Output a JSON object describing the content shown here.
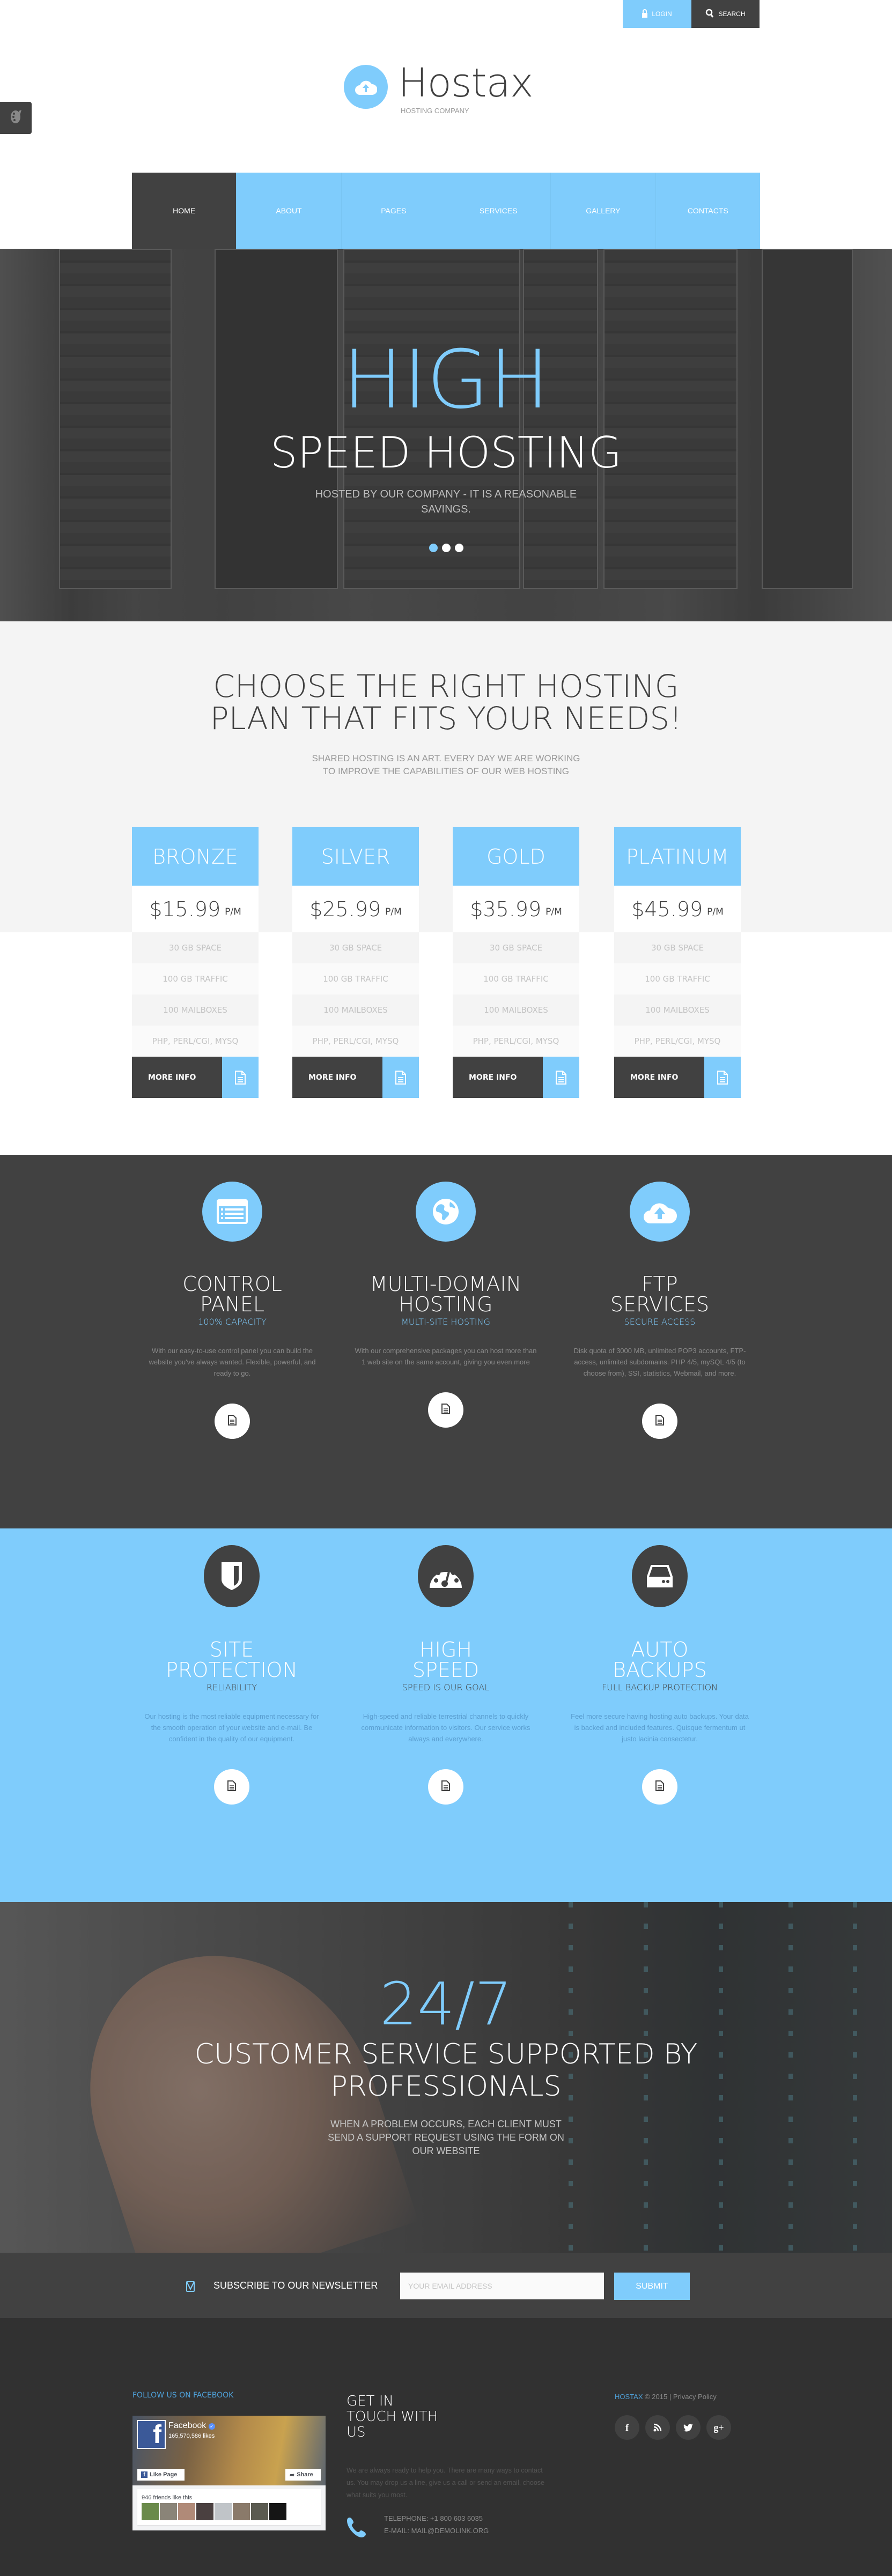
{
  "topbar": {
    "login_label": "LOGIN",
    "search_label": "SEARCH"
  },
  "brand": {
    "name": "Hostax",
    "tagline": "HOSTING COMPANY"
  },
  "nav": {
    "items": [
      {
        "label": "HOME",
        "active": true
      },
      {
        "label": "ABOUT"
      },
      {
        "label": "PAGES"
      },
      {
        "label": "SERVICES"
      },
      {
        "label": "GALLERY"
      },
      {
        "label": "CONTACTS"
      }
    ]
  },
  "hero": {
    "title": "HIGH",
    "subtitle": "SPEED HOSTING",
    "text": "HOSTED BY OUR COMPANY - IT IS A REASONABLE SAVINGS.",
    "slides": 3,
    "active_slide": 1
  },
  "plans": {
    "title_line1": "CHOOSE THE RIGHT HOSTING",
    "title_line2": "PLAN THAT FITS YOUR NEEDS!",
    "sub_line1": "SHARED HOSTING IS AN ART. EVERY DAY WE ARE WORKING",
    "sub_line2": "TO IMPROVE THE CAPABILITIES OF OUR WEB HOSTING",
    "items": [
      {
        "name": "BRONZE",
        "price": "$15.99",
        "period": "P/M",
        "features": [
          "30 GB SPACE",
          "100 GB TRAFFIC",
          "100 MAILBOXES",
          "PHP, PERL/CGI, MYSQ"
        ],
        "button": "MORE INFO"
      },
      {
        "name": "SILVER",
        "price": "$25.99",
        "period": "P/M",
        "features": [
          "30 GB SPACE",
          "100 GB TRAFFIC",
          "100 MAILBOXES",
          "PHP, PERL/CGI, MYSQ"
        ],
        "button": "MORE INFO"
      },
      {
        "name": "GOLD",
        "price": "$35.99",
        "period": "P/M",
        "features": [
          "30 GB SPACE",
          "100 GB TRAFFIC",
          "100 MAILBOXES",
          "PHP, PERL/CGI, MYSQ"
        ],
        "button": "MORE INFO"
      },
      {
        "name": "PLATINUM",
        "price": "$45.99",
        "period": "P/M",
        "features": [
          "30 GB SPACE",
          "100 GB TRAFFIC",
          "100 MAILBOXES",
          "PHP, PERL/CGI, MYSQ"
        ],
        "button": "MORE INFO"
      }
    ]
  },
  "features_dark": [
    {
      "icon": "control-panel-icon",
      "title1": "CONTROL",
      "title2": "PANEL",
      "sub": "100% CAPACITY",
      "desc": "With our easy-to-use control panel you can build the website you've always wanted. Flexible, powerful, and ready to go."
    },
    {
      "icon": "globe-icon",
      "title1": "MULTI-DOMAIN",
      "title2": "HOSTING",
      "sub": "MULTI-SITE HOSTING",
      "desc": "With our comprehensive packages you can host more than 1 web site on the same account, giving you even more"
    },
    {
      "icon": "cloud-upload-icon",
      "title1": "FTP",
      "title2": "SERVICES",
      "sub": "SECURE ACCESS",
      "desc": "Disk quota of 3000 MB, unlimited POP3 accounts, FTP-access, unlimited subdomains. PHP 4/5, mySQL 4/5 (to choose from), SSI, statistics, Webmail, and more."
    }
  ],
  "features_light": [
    {
      "icon": "shield-icon",
      "title1": "SITE",
      "title2": "PROTECTION",
      "sub": "RELIABILITY",
      "desc": "Our hosting is the most reliable equipment necessary for the smooth operation of your website and e-mail. Be confident in the quality of our equipment."
    },
    {
      "icon": "speedometer-icon",
      "title1": "HIGH",
      "title2": "SPEED",
      "sub": "SPEED IS OUR GOAL",
      "desc": "High-speed and reliable terrestrial channels to quickly communicate information to visitors. Our service works always and everywhere."
    },
    {
      "icon": "hard-drive-icon",
      "title1": "AUTO",
      "title2": "BACKUPS",
      "sub": "FULL BACKUP PROTECTION",
      "desc": "Feel more secure having hosting auto backups. Your data is backed and included features. Quisque fermentum ut justo lacinia consectetur."
    }
  ],
  "support": {
    "title": "24/7",
    "subtitle_line1": "CUSTOMER SERVICE SUPPORTED BY",
    "subtitle_line2": "PROFESSIONALS",
    "text": "WHEN A PROBLEM OCCURS, EACH CLIENT MUST SEND A SUPPORT REQUEST USING THE FORM ON OUR WEBSITE"
  },
  "newsletter": {
    "label": "SUBSCRIBE TO OUR NEWSLETTER",
    "placeholder": "YOUR EMAIL ADDRESS",
    "value": "",
    "submit": "SUBMIT"
  },
  "footer": {
    "facebook_label": "FOLLOW US ON FACEBOOK",
    "fb_widget": {
      "page_name": "Facebook",
      "likes": "165,570,586 likes",
      "like_button": "Like Page",
      "share_button": "Share",
      "friends_text": "946 friends like this",
      "friend_avatars": 8
    },
    "contact_title_lines": [
      "GET IN",
      "TOUCH WITH",
      "US"
    ],
    "contact_desc": "We are always ready to help you. There are many ways to contact us. You may drop us a line, give us a call or send an email, choose what suits you most.",
    "telephone": "TELEPHONE: +1 800 603 6035",
    "email": "E-MAIL: MAIL@DEMOLINK.ORG",
    "copyright_brand": "HOSTAX",
    "copyright_text": " © 2015 | ",
    "privacy_link": "Privacy Policy",
    "socials": [
      {
        "name": "facebook",
        "glyph": "f"
      },
      {
        "name": "rss",
        "glyph": "◉"
      },
      {
        "name": "twitter",
        "glyph": "t"
      },
      {
        "name": "google-plus",
        "glyph": "g+"
      }
    ]
  },
  "colors": {
    "accent": "#7fccfc",
    "dark": "#414141",
    "footer": "#313131",
    "light_bg": "#f4f4f4"
  }
}
